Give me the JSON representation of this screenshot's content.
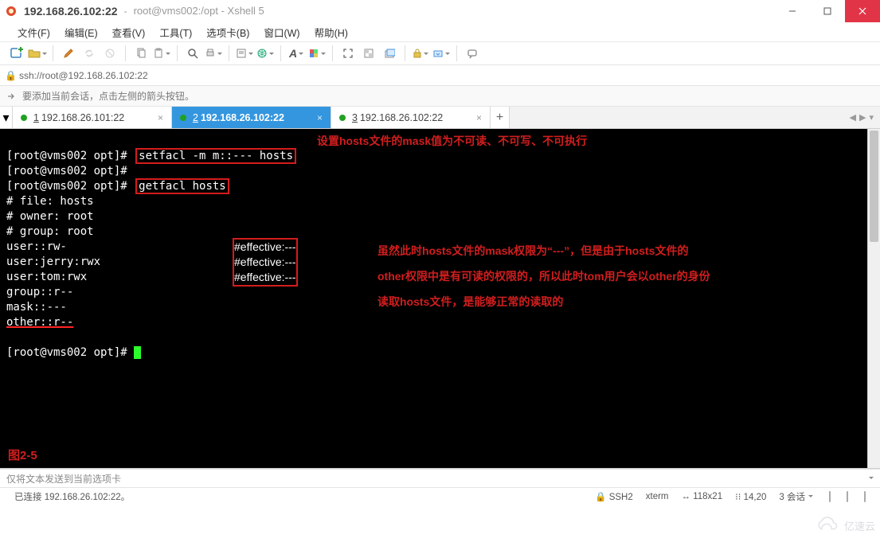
{
  "title": {
    "ip": "192.168.26.102:22",
    "path": "root@vms002:/opt - Xshell 5"
  },
  "menu": {
    "file": "文件(F)",
    "edit": "编辑(E)",
    "view": "查看(V)",
    "tools": "工具(T)",
    "tabs": "选项卡(B)",
    "window": "窗口(W)",
    "help": "帮助(H)"
  },
  "address": {
    "url": "ssh://root@192.168.26.102:22"
  },
  "hint": {
    "text": "要添加当前会话，点击左侧的箭头按钮。"
  },
  "sessionTabs": {
    "items": [
      {
        "num": "1",
        "label": "192.168.26.101:22",
        "active": false
      },
      {
        "num": "2",
        "label": "192.168.26.102:22",
        "active": true
      },
      {
        "num": "3",
        "label": "192.168.26.102:22",
        "active": false
      }
    ],
    "add": "+"
  },
  "terminal": {
    "prompt": "[root@vms002 opt]#",
    "cmd1": "setfacl -m m::--- hosts",
    "cmd2": "getfacl hosts",
    "out": {
      "l1": "# file: hosts",
      "l2": "# owner: root",
      "l3": "# group: root",
      "l4": "user::rw-",
      "l5": "user:jerry:rwx",
      "l6": "user:tom:rwx",
      "l7": "group::r--",
      "l8": "mask::---",
      "l9": "other::r--"
    },
    "eff": {
      "e1": "#effective:---",
      "e2": "#effective:---",
      "e3": "#effective:---"
    },
    "annotations": {
      "a1": "设置hosts文件的mask值为不可读、不可写、不可执行",
      "a2": "虽然此时hosts文件的mask权限为“---”，但是由于hosts文件的",
      "a3": "other权限中是有可读的权限的，所以此时tom用户会以other的身份",
      "a4": "读取hosts文件，是能够正常的读取的"
    },
    "figLabel": "图2-5"
  },
  "sendbar": {
    "text": "仅将文本发送到当前选项卡"
  },
  "status": {
    "left": "已连接 192.168.26.102:22。",
    "ssh": "SSH2",
    "term": "xterm",
    "size": "118x21",
    "pos": "14,20",
    "sessions": "3 会话",
    "lock": "⇧"
  },
  "watermark": {
    "text": "亿速云"
  },
  "tabnav": {
    "left": "◀",
    "right": "▶",
    "dd": "▾"
  }
}
